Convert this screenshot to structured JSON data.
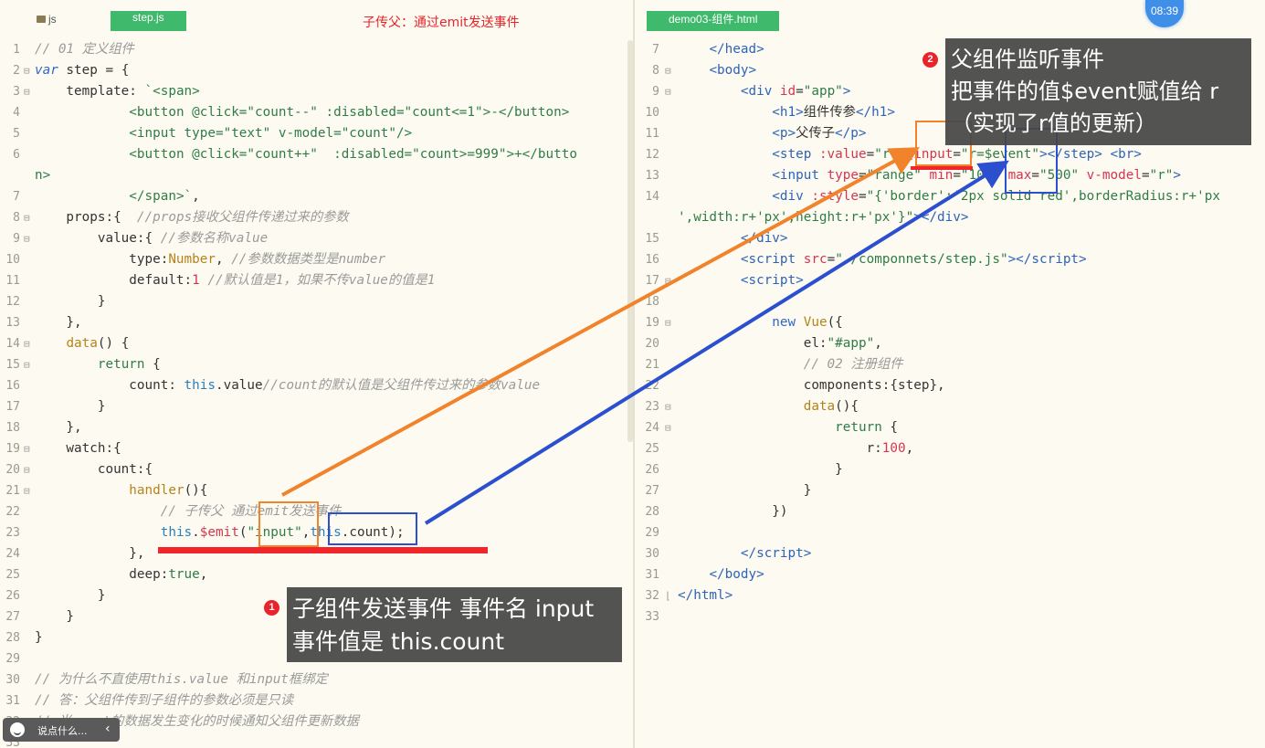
{
  "left_pane": {
    "folder_label": "js",
    "tab_label": "step.js",
    "caption": "子传父：通过emit发送事件"
  },
  "right_pane": {
    "tab_label": "demo03-组件.html"
  },
  "clock": "08:39",
  "callouts": {
    "one": {
      "badge": "1",
      "line1": "子组件发送事件 事件名 input",
      "line2": "事件值是 this.count"
    },
    "two": {
      "badge": "2",
      "line1": "父组件监听事件",
      "line2": "把事件的值$event赋值给 r",
      "line3": "（实现了r值的更新）"
    }
  },
  "chat_bubble": {
    "placeholder": "说点什么..."
  },
  "left_code": [
    {
      "n": "1",
      "fold": "",
      "html": "<span class='c'>// 01 定义组件</span>"
    },
    {
      "n": "2",
      "fold": "⊟",
      "html": "<span class='kw' style='font-style:italic'>var</span> step = {"
    },
    {
      "n": "3",
      "fold": "⊟",
      "html": "    template: <span class='s'>`&lt;span&gt;</span>"
    },
    {
      "n": "4",
      "fold": "",
      "html": "            <span class='s'>&lt;button @click=\"count--\" :disabled=\"count&lt;=1\"&gt;-&lt;/button&gt;</span>"
    },
    {
      "n": "5",
      "fold": "",
      "html": "            <span class='s'>&lt;input type=\"text\" v-model=\"count\"/&gt;</span>"
    },
    {
      "n": "6",
      "fold": "",
      "html": "            <span class='s'>&lt;button @click=\"count++\"  :disabled=\"count&gt;=999\"&gt;+&lt;/butto</span>"
    },
    {
      "n": "",
      "fold": "",
      "html": "<span class='s'>n&gt;</span>"
    },
    {
      "n": "7",
      "fold": "",
      "html": "            <span class='s'>&lt;/span&gt;`</span>,"
    },
    {
      "n": "8",
      "fold": "⊟",
      "html": "    props:{  <span class='c'>//props接收父组件传递过来的参数</span>"
    },
    {
      "n": "9",
      "fold": "⊟",
      "html": "        value:{ <span class='c'>//参数名称value</span>"
    },
    {
      "n": "10",
      "fold": "",
      "html": "            type:<span class='a'>Number</span>, <span class='c'>//参数数据类型是number</span>"
    },
    {
      "n": "11",
      "fold": "",
      "html": "            default:<span class='n'>1</span> <span class='c'>//默认值是1，如果不传value的值是1</span>"
    },
    {
      "n": "12",
      "fold": "",
      "html": "        }"
    },
    {
      "n": "13",
      "fold": "",
      "html": "    },"
    },
    {
      "n": "14",
      "fold": "⊟",
      "html": "    <span class='fn'>data</span>() {"
    },
    {
      "n": "15",
      "fold": "⊟",
      "html": "        <span class='s'>return</span> {"
    },
    {
      "n": "16",
      "fold": "",
      "html": "            count: <span class='k'>this</span>.value<span class='c'>//count的默认值是父组件传过来的参数value</span>"
    },
    {
      "n": "17",
      "fold": "",
      "html": "        }"
    },
    {
      "n": "18",
      "fold": "",
      "html": "    },"
    },
    {
      "n": "19",
      "fold": "⊟",
      "html": "    watch:{"
    },
    {
      "n": "20",
      "fold": "⊟",
      "html": "        count:{"
    },
    {
      "n": "21",
      "fold": "⊟",
      "html": "            <span class='fn'>handler</span>(){"
    },
    {
      "n": "22",
      "fold": "",
      "html": "                <span class='c'>// 子传父 通过emit发送事件</span>"
    },
    {
      "n": "23",
      "fold": "",
      "html": "                <span class='k'>this</span>.<span class='n'>$emit</span>(<span class='s'>\"input\"</span>,<span class='k'>this</span>.count);"
    },
    {
      "n": "24",
      "fold": "",
      "html": "            },"
    },
    {
      "n": "25",
      "fold": "",
      "html": "            deep:<span class='s'>true</span>,"
    },
    {
      "n": "26",
      "fold": "",
      "html": "        }"
    },
    {
      "n": "27",
      "fold": "",
      "html": "    }"
    },
    {
      "n": "28",
      "fold": "",
      "html": "}"
    },
    {
      "n": "29",
      "fold": "",
      "html": ""
    },
    {
      "n": "30",
      "fold": "",
      "html": "<span class='c'>// 为什么不直使用this.value 和input框绑定</span>"
    },
    {
      "n": "31",
      "fold": "",
      "html": "<span class='c'>// 答：父组件传到子组件的参数必须是只读</span>"
    },
    {
      "n": "32",
      "fold": "",
      "html": "<span class='c'>// 当count的数据发生变化的时候通知父组件更新数据</span>"
    },
    {
      "n": "33",
      "fold": "",
      "html": ""
    }
  ],
  "right_code": [
    {
      "n": "7",
      "fold": "",
      "html": "    <span class='tg'>&lt;/head&gt;</span>"
    },
    {
      "n": "8",
      "fold": "⊟",
      "html": "    <span class='tg'>&lt;body&gt;</span>"
    },
    {
      "n": "9",
      "fold": "⊟",
      "html": "        <span class='tg'>&lt;div</span> <span class='n'>id</span>=<span class='s'>\"app\"</span><span class='tg'>&gt;</span>"
    },
    {
      "n": "10",
      "fold": "",
      "html": "            <span class='tg'>&lt;h1&gt;</span>组件传参<span class='tg'>&lt;/h1&gt;</span>"
    },
    {
      "n": "11",
      "fold": "",
      "html": "            <span class='tg'>&lt;p&gt;</span>父传子<span class='tg'>&lt;/p&gt;</span>"
    },
    {
      "n": "12",
      "fold": "",
      "html": "            <span class='tg'>&lt;step</span> <span class='n'>:value</span>=<span class='s'>\"r\"</span> <span class='n'>@input</span>=<span class='s'>\"r=$event\"</span><span class='tg'>&gt;&lt;/step&gt;</span> <span class='tg'>&lt;br&gt;</span>"
    },
    {
      "n": "13",
      "fold": "",
      "html": "            <span class='tg'>&lt;input</span> <span class='n'>type</span>=<span class='s'>\"range\"</span> <span class='n'>min</span>=<span class='s'>\"100\"</span> <span class='n'>max</span>=<span class='s'>\"500\"</span> <span class='n'>v-model</span>=<span class='s'>\"r\"</span><span class='tg'>&gt;</span>"
    },
    {
      "n": "14",
      "fold": "",
      "html": "            <span class='tg'>&lt;div</span> <span class='n'>:style</span>=<span class='s'>\"{'border':'2px solid red',borderRadius:r+'px</span>"
    },
    {
      "n": "",
      "fold": "",
      "html": "<span class='s'>',width:r+'px',height:r+'px'}\"</span><span class='tg'>&gt;&lt;/div&gt;</span>"
    },
    {
      "n": "15",
      "fold": "",
      "html": "        <span class='tg'>&lt;/div&gt;</span>"
    },
    {
      "n": "16",
      "fold": "",
      "html": "        <span class='tg'>&lt;script</span> <span class='n'>src</span>=<span class='s'>\"./componnets/step.js\"</span><span class='tg'>&gt;&lt;/script&gt;</span>"
    },
    {
      "n": "17",
      "fold": "⊟",
      "html": "        <span class='tg'>&lt;script&gt;</span>"
    },
    {
      "n": "18",
      "fold": "",
      "html": ""
    },
    {
      "n": "19",
      "fold": "⊟",
      "html": "            <span class='kw'>new</span> <span class='fn'>Vue</span>({"
    },
    {
      "n": "20",
      "fold": "",
      "html": "                el:<span class='s'>\"#app\"</span>,"
    },
    {
      "n": "21",
      "fold": "",
      "html": "                <span class='c'>// 02 注册组件</span>"
    },
    {
      "n": "22",
      "fold": "",
      "html": "                components:{step},"
    },
    {
      "n": "23",
      "fold": "⊟",
      "html": "                <span class='fn'>data</span>(){"
    },
    {
      "n": "24",
      "fold": "⊟",
      "html": "                    <span class='s'>return</span> {"
    },
    {
      "n": "25",
      "fold": "",
      "html": "                        r:<span class='n'>100</span>,"
    },
    {
      "n": "26",
      "fold": "",
      "html": "                    }"
    },
    {
      "n": "27",
      "fold": "",
      "html": "                }"
    },
    {
      "n": "28",
      "fold": "",
      "html": "            })"
    },
    {
      "n": "29",
      "fold": "",
      "html": ""
    },
    {
      "n": "30",
      "fold": "",
      "html": "        <span class='tg'>&lt;/script&gt;</span>"
    },
    {
      "n": "31",
      "fold": "",
      "html": "    <span class='tg'>&lt;/body&gt;</span>"
    },
    {
      "n": "32",
      "fold": "⌊",
      "html": "<span class='tg'>&lt;/html&gt;</span>"
    },
    {
      "n": "33",
      "fold": "",
      "html": ""
    }
  ]
}
